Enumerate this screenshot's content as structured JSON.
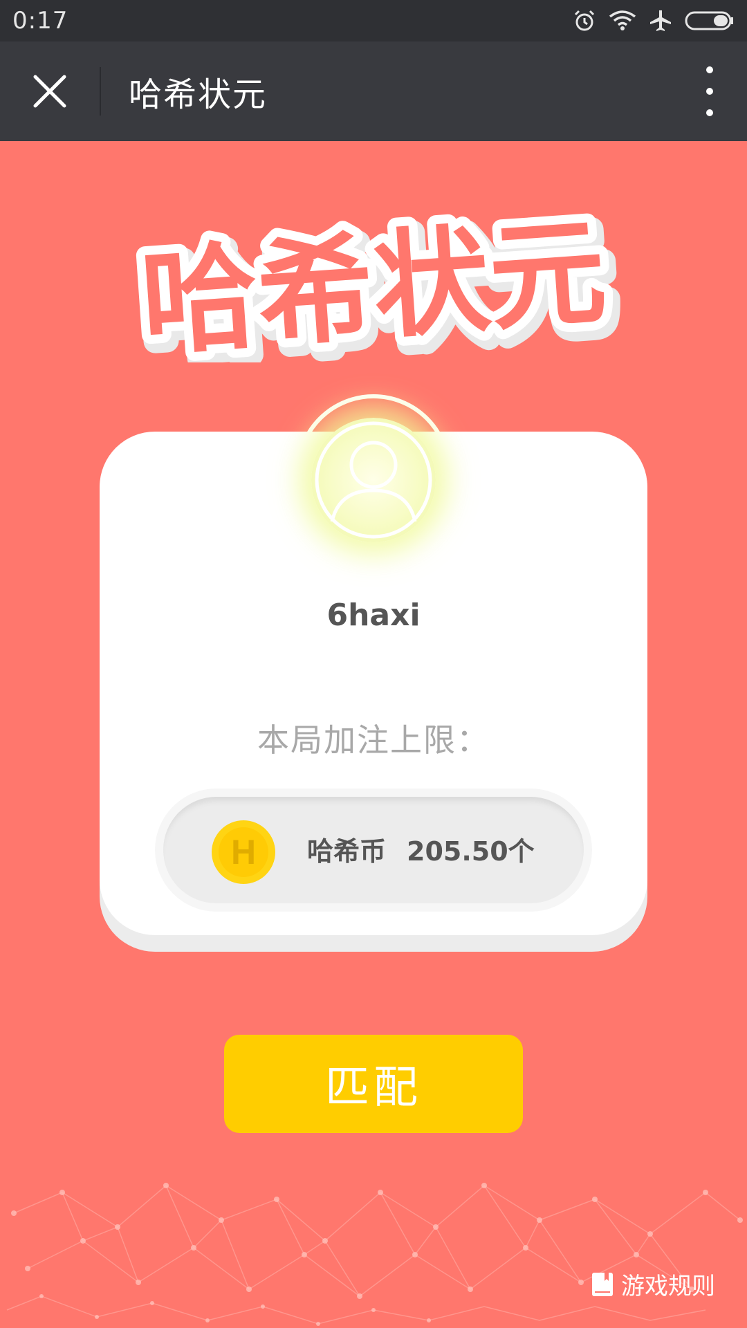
{
  "status_bar": {
    "time": "0:17",
    "icons": [
      "alarm-icon",
      "wifi-icon",
      "airplane-mode-icon",
      "battery-icon"
    ]
  },
  "nav_bar": {
    "title": "哈希状元",
    "close_icon": "close-icon",
    "more_icon": "more-vertical-icon"
  },
  "main": {
    "logo_text": "哈希状元",
    "card": {
      "avatar_icon": "user-avatar-icon",
      "username": "6haxi",
      "limit_label": "本局加注上限：",
      "coin_icon_letter": "H",
      "currency_label": "哈希币",
      "amount": "205.50个"
    },
    "match_button_label": "匹配",
    "rules_link_label": "游戏规则",
    "rules_icon": "book-icon"
  },
  "colors": {
    "background": "#ff776d",
    "nav_bar": "#393a3f",
    "status_bar": "#2f3034",
    "button": "#ffcd00",
    "coin": "#ffcb05"
  }
}
